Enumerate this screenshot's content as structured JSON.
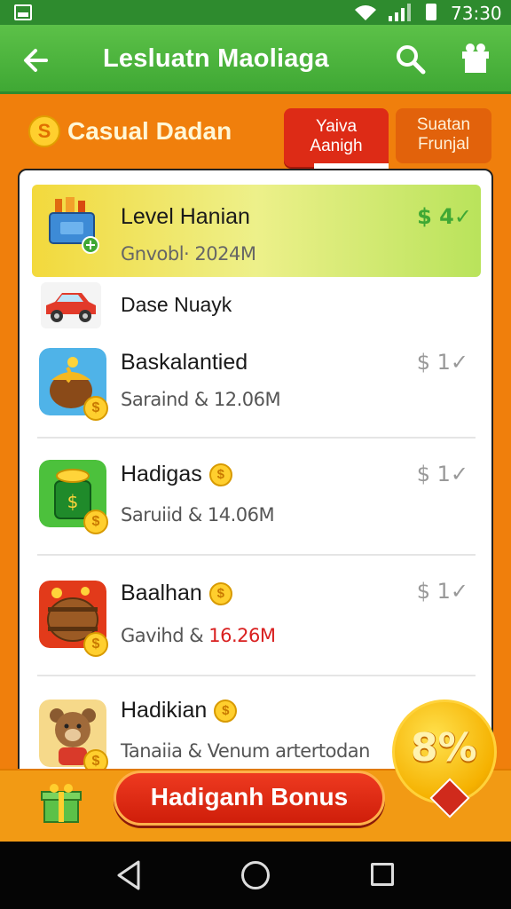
{
  "status_bar": {
    "time": "73:30"
  },
  "app_bar": {
    "title": "Lesluatn Maoliaga"
  },
  "section": {
    "title": "Casual Dadan",
    "coin_glyph": "S",
    "tab_active": {
      "line1": "Yaiva",
      "line2": "Aanigh"
    },
    "tab_inactive": {
      "line1": "Suatan",
      "line2": "Frunjal"
    }
  },
  "list": {
    "highlight": {
      "title": "Level Hanian",
      "sub": "Gnvobl· 2024M",
      "amount": "$ 4✓"
    },
    "header_row": {
      "title": "Dase Nuayk"
    },
    "items": [
      {
        "title": "Baskalantied",
        "sub": "Saraind & 12.06M",
        "amount": "$ 1✓"
      },
      {
        "title": "Hadigas",
        "sub": "Saruiid & 14.06M",
        "amount": "$ 1✓"
      },
      {
        "title": "Baalhan",
        "sub_prefix": "Gavihd & ",
        "sub_value": "16.26M",
        "amount": "$ 1✓"
      },
      {
        "title": "Hadikian",
        "sub": "Tanaiia & Venum artertodan"
      }
    ]
  },
  "bottom": {
    "bonus_label": "Hadiganh Bonus",
    "promo_text": "8%"
  },
  "colors": {
    "green": "#3fa834",
    "orange": "#f07f0c",
    "red": "#dd2b16",
    "gold": "#ffcf2e"
  }
}
